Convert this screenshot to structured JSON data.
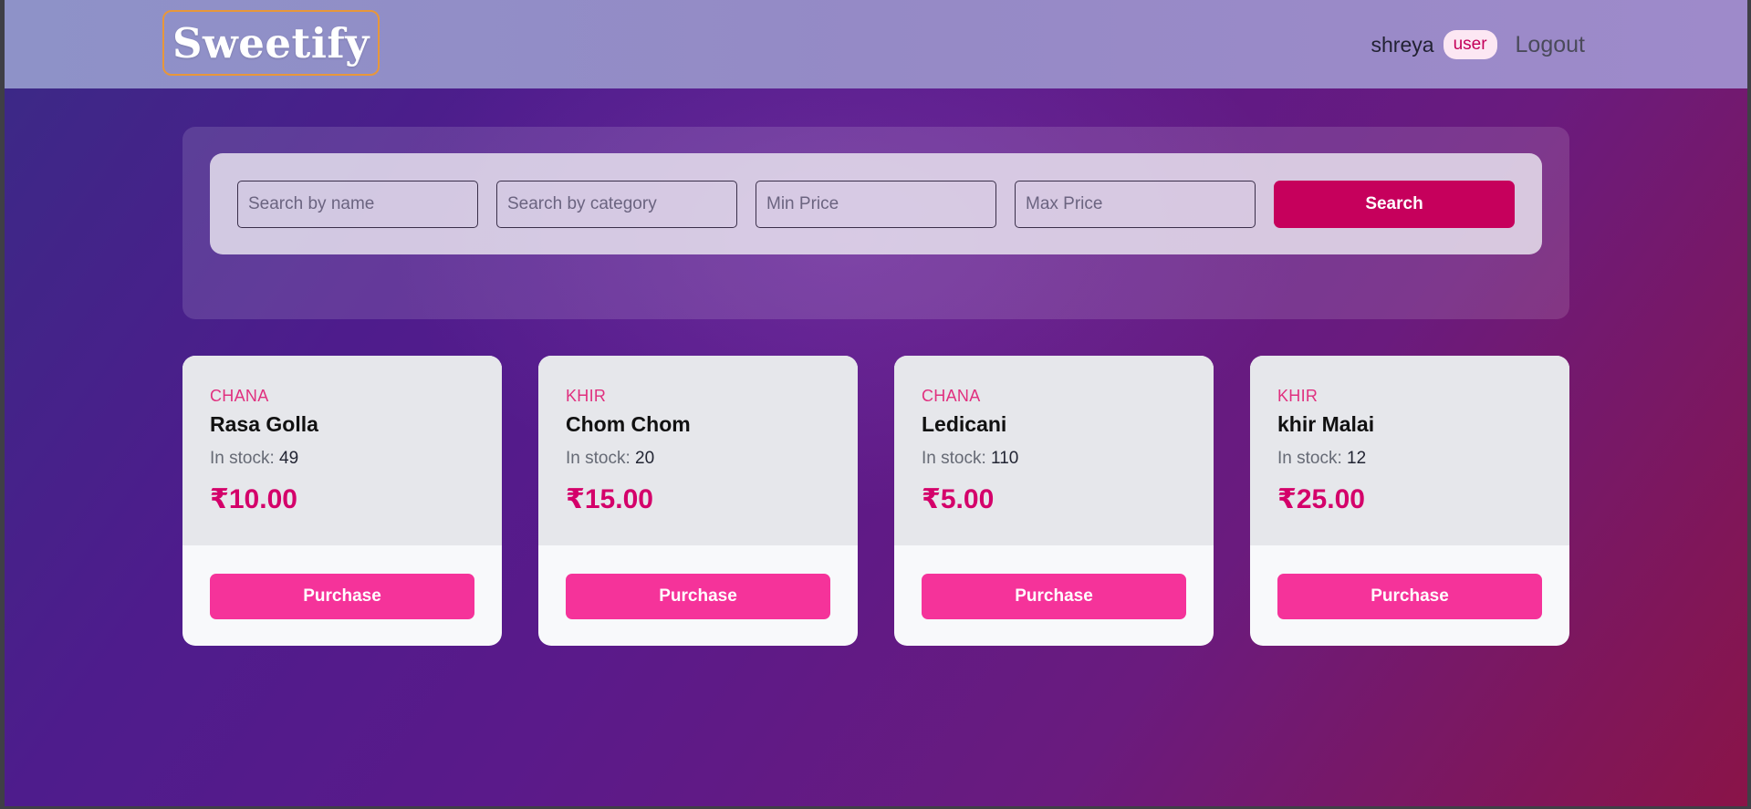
{
  "header": {
    "logo": "Sweetify",
    "username": "shreya",
    "role": "user",
    "logout_label": "Logout"
  },
  "search": {
    "name_placeholder": "Search by name",
    "category_placeholder": "Search by category",
    "min_price_placeholder": "Min Price",
    "max_price_placeholder": "Max Price",
    "button_label": "Search"
  },
  "products": [
    {
      "category": "CHANA",
      "name": "Rasa Golla",
      "stock_label": "In stock:",
      "stock": "49",
      "price": "₹10.00",
      "button_label": "Purchase"
    },
    {
      "category": "KHIR",
      "name": "Chom Chom",
      "stock_label": "In stock:",
      "stock": "20",
      "price": "₹15.00",
      "button_label": "Purchase"
    },
    {
      "category": "CHANA",
      "name": "Ledicani",
      "stock_label": "In stock:",
      "stock": "110",
      "price": "₹5.00",
      "button_label": "Purchase"
    },
    {
      "category": "KHIR",
      "name": "khir Malai",
      "stock_label": "In stock:",
      "stock": "12",
      "price": "₹25.00",
      "button_label": "Purchase"
    }
  ],
  "colors": {
    "accent": "#c6005c",
    "purchase_button": "#f5339a",
    "price": "#d4006a",
    "category": "#e0307f",
    "logo_border": "#e8973a"
  }
}
